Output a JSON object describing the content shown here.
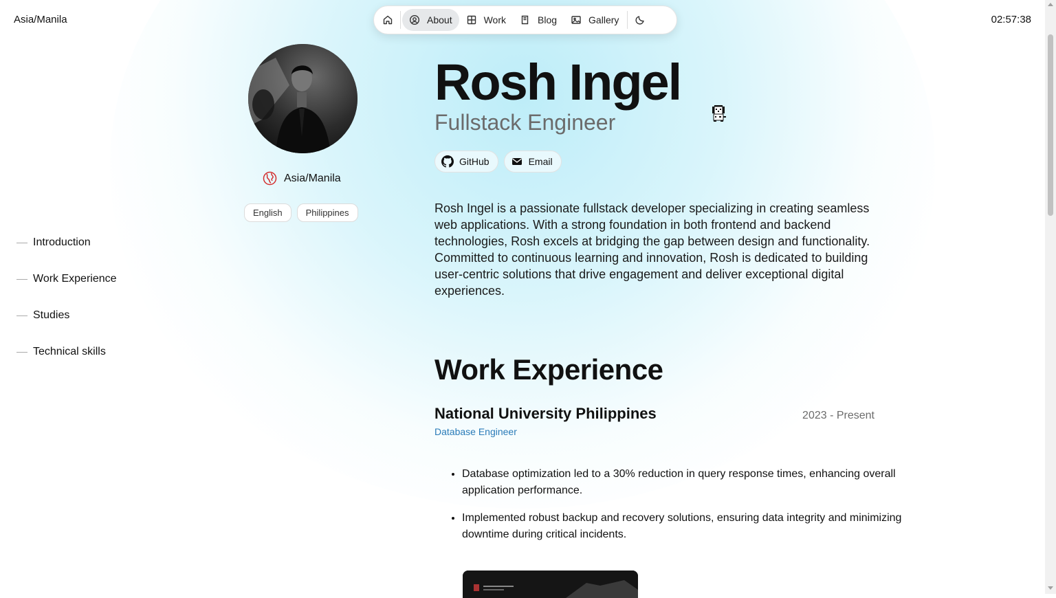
{
  "header": {
    "timezone": "Asia/Manila",
    "clock": "02:57:38"
  },
  "nav": {
    "items": [
      {
        "label": "",
        "icon": "home-icon"
      },
      {
        "label": "About",
        "icon": "user-circle-icon",
        "active": true
      },
      {
        "label": "Work",
        "icon": "grid-icon"
      },
      {
        "label": "Blog",
        "icon": "book-icon"
      },
      {
        "label": "Gallery",
        "icon": "gallery-icon"
      }
    ],
    "theme_toggle_icon": "moon-icon"
  },
  "profile": {
    "location": "Asia/Manila",
    "languages": [
      "English",
      "Philippines"
    ]
  },
  "toc": [
    "Introduction",
    "Work Experience",
    "Studies",
    "Technical skills"
  ],
  "intro": {
    "name": "Rosh Ingel",
    "role": "Fullstack Engineer",
    "links": [
      {
        "label": "GitHub",
        "icon": "github-icon"
      },
      {
        "label": "Email",
        "icon": "email-icon"
      }
    ],
    "bio": "Rosh Ingel is a passionate fullstack developer specializing in creating seamless web applications. With a strong foundation in both frontend and backend technologies, Rosh excels at bridging the gap between design and functionality. Committed to continuous learning and innovation, Rosh is dedicated to building user-centric solutions that drive engagement and deliver exceptional digital experiences."
  },
  "work": {
    "title": "Work Experience",
    "entries": [
      {
        "company": "National University Philippines",
        "period": "2023 - Present",
        "position": "Database Engineer",
        "achievements": [
          "Database optimization led to a 30% reduction in query response times, enhancing overall application performance.",
          "Implemented robust backup and recovery solutions, ensuring data integrity and minimizing downtime during critical incidents."
        ]
      }
    ]
  },
  "colors": {
    "accent": "#2a7bb8",
    "glow": "#c6f0f8",
    "location_icon": "#d32f2f"
  }
}
